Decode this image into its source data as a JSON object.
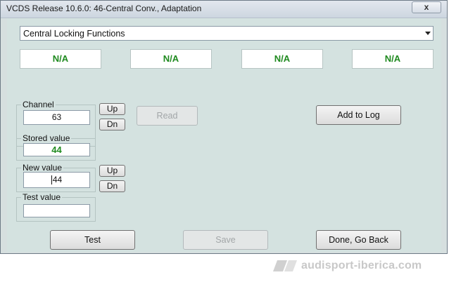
{
  "window": {
    "title": "VCDS Release 10.6.0: 46-Central Conv.,  Adaptation",
    "close_label": "x"
  },
  "function_select": {
    "value": "Central Locking Functions"
  },
  "status_values": [
    "N/A",
    "N/A",
    "N/A",
    "N/A"
  ],
  "channel": {
    "label": "Channel",
    "value": "63",
    "up_label": "Up",
    "down_label": "Dn"
  },
  "read_button": "Read",
  "add_to_log_button": "Add to Log",
  "stored_value": {
    "label": "Stored value",
    "value": "44"
  },
  "new_value": {
    "label": "New value",
    "value": "44",
    "up_label": "Up",
    "down_label": "Dn"
  },
  "test_value": {
    "label": "Test value",
    "value": ""
  },
  "bottom_buttons": {
    "test": "Test",
    "save": "Save",
    "done": "Done, Go Back"
  },
  "watermark": {
    "text": "audisport-iberica.com"
  },
  "colors": {
    "client_bg": "#d4e2e0",
    "value_green": "#1f8a1f"
  }
}
